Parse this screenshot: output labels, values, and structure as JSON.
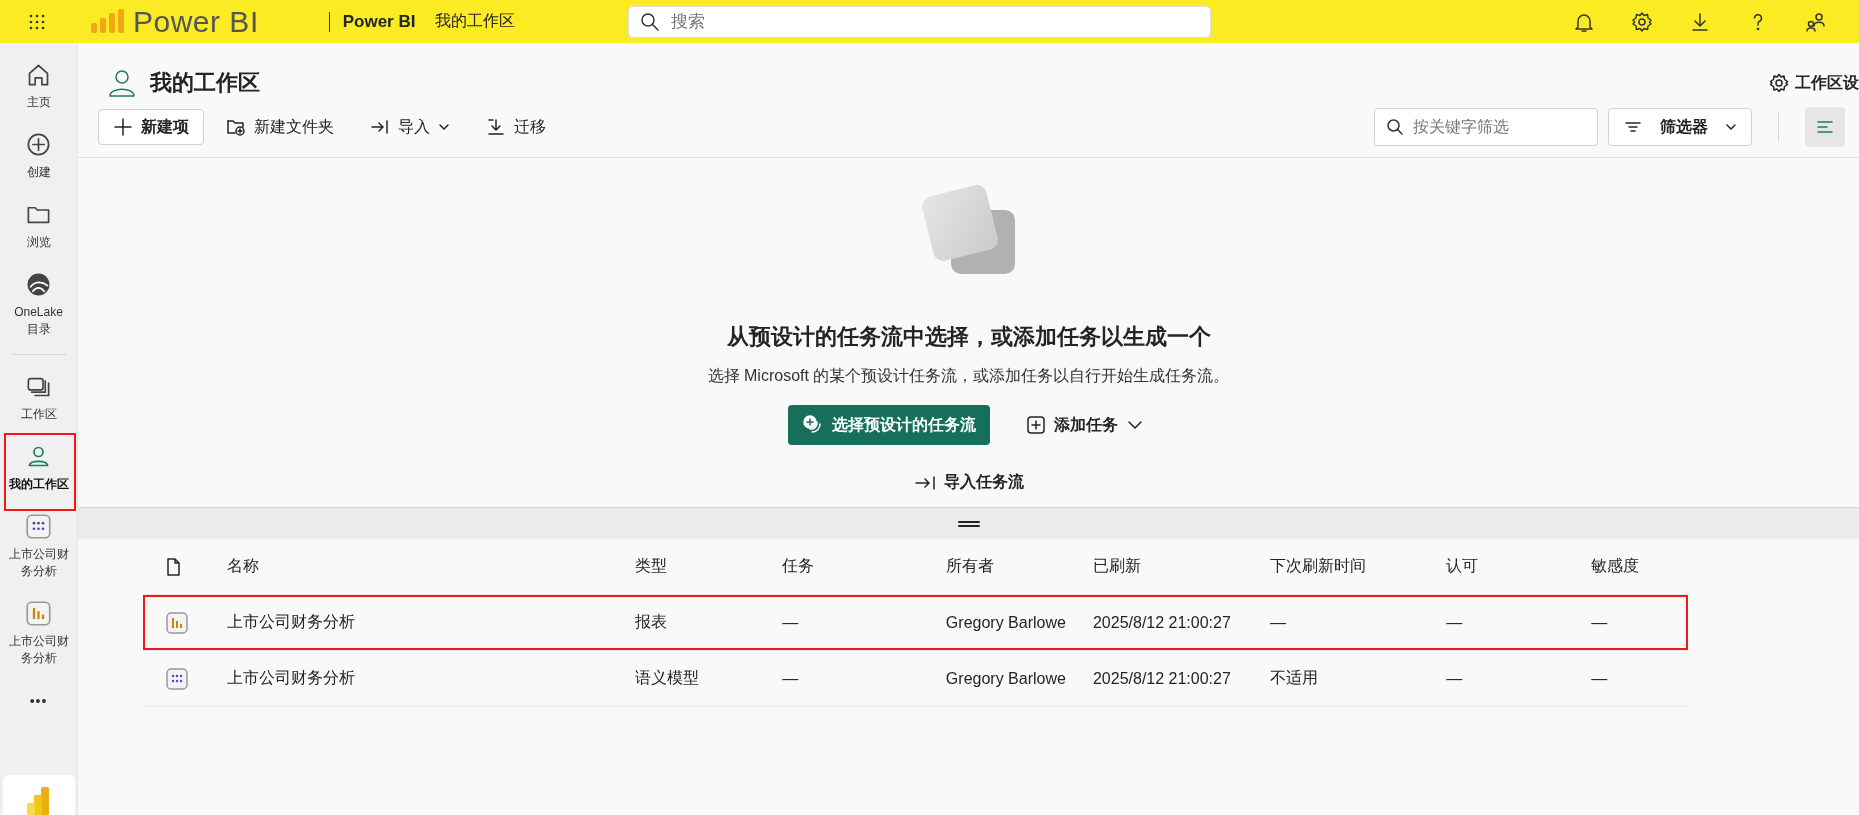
{
  "top_bar": {
    "logo": "Power BI",
    "product": "Power BI",
    "workspace": "我的工作区",
    "search": {
      "placeholder": "搜索"
    }
  },
  "sidebar": {
    "items": [
      {
        "kind": "home",
        "label": "主页",
        "selected": false,
        "highlighted": false
      },
      {
        "kind": "create",
        "label": "创建",
        "selected": false,
        "highlighted": false
      },
      {
        "kind": "browse",
        "label": "浏览",
        "selected": false,
        "highlighted": false
      },
      {
        "kind": "onelake",
        "label": "OneLake 目录",
        "selected": false,
        "highlighted": false
      },
      {
        "kind": "divider"
      },
      {
        "kind": "workspaces",
        "label": "工作区",
        "selected": false,
        "highlighted": false
      },
      {
        "kind": "my_workspace",
        "label": "我的工作区",
        "selected": true,
        "highlighted": true
      },
      {
        "kind": "semantic_model",
        "label": "上市公司财务分析",
        "selected": false,
        "highlighted": false
      },
      {
        "kind": "report",
        "label": "上市公司财务分析",
        "selected": false,
        "highlighted": false
      },
      {
        "kind": "more",
        "label": "•••",
        "selected": false,
        "highlighted": false
      }
    ]
  },
  "header": {
    "title": "我的工作区",
    "settings": "工作区设"
  },
  "toolbar": {
    "actions": [
      {
        "kind": "new",
        "label": "新建项"
      },
      {
        "kind": "folder",
        "label": "新建文件夹"
      },
      {
        "kind": "import",
        "label": "导入"
      },
      {
        "kind": "migrate",
        "label": "迁移"
      }
    ],
    "filter": {
      "placeholder": "按关键字筛选"
    },
    "filter_button": "筛选器",
    "list_view": {
      "selected": true
    }
  },
  "empty_state": {
    "title": "从预设计的任务流中选择，或添加任务以生成一个",
    "subtitle": "选择 Microsoft 的某个预设计任务流，或添加任务以自行开始生成任务流。",
    "primary": "选择预设计的任务流",
    "secondary": "添加任务",
    "import": "导入任务流"
  },
  "table": {
    "columns": [
      "名称",
      "类型",
      "任务",
      "所有者",
      "已刷新",
      "下次刷新时间",
      "认可",
      "敏感度"
    ],
    "rows": [
      {
        "kind": "report",
        "highlighted": true,
        "cells": [
          "上市公司财务分析",
          "报表",
          "—",
          "Gregory Barlowe",
          "2025/8/12 21:00:27",
          "—",
          "—",
          "—"
        ]
      },
      {
        "kind": "semantic_model",
        "highlighted": false,
        "cells": [
          "上市公司财务分析",
          "语义模型",
          "—",
          "Gregory Barlowe",
          "2025/8/12 21:00:27",
          "不适用",
          "—",
          "—"
        ]
      }
    ]
  }
}
